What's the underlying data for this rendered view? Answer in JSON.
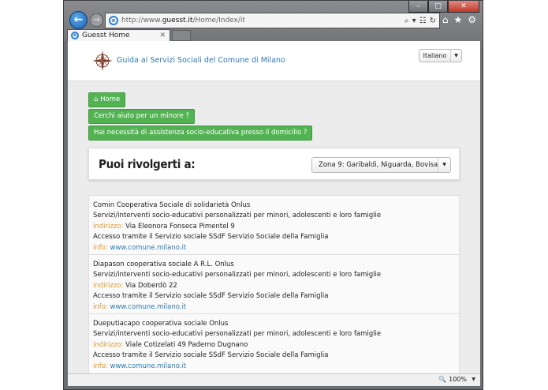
{
  "browser": {
    "url_prefix": "http://www.",
    "url_domain": "guesst.it",
    "url_path": "/Home/Index/it",
    "tab_title": "Guesst Home",
    "window_buttons": {
      "minimize": "–",
      "maximize": "□",
      "close": "✕"
    },
    "nav": {
      "back": "←",
      "forward": "→"
    },
    "address_tools": {
      "search": "⌕",
      "dropdown": "▾",
      "compat": "☷",
      "refresh": "↻"
    },
    "toolbar_icons": {
      "home": "⌂",
      "favorites": "★",
      "tools": "⚙"
    },
    "tab_close": "✕",
    "zoom": "100%",
    "icons": [
      "back-arrow-icon",
      "forward-arrow-icon",
      "ie-icon",
      "search-icon",
      "refresh-icon",
      "home-icon",
      "favorites-star-icon",
      "gear-icon",
      "zoom-icon"
    ]
  },
  "site": {
    "title": "Guida ai Servizi Sociali del Comune di Milano",
    "language": "Italiano",
    "logo_icon": "compass-rose-icon"
  },
  "breadcrumbs": [
    {
      "label": "Home",
      "icon": "home-icon"
    },
    {
      "label": "Cerchi aiuto per un minore ?"
    },
    {
      "label": "Hai necessità di assistenza socio-educativa presso il domicilio ?"
    }
  ],
  "filter": {
    "title": "Puoi rivolgerti a:",
    "zone": "Zona 9: Garibaldi, Niguarda, Bovisa"
  },
  "results": [
    {
      "name": "Comin Cooperativa Sociale di solidarietà Onlus",
      "service": "Servizi/interventi socio-educativi personalizzati per minori, adolescenti e loro famiglie",
      "address_label": "indirizzo:",
      "address": "Via Eleonora Fonseca Pimentel 9",
      "access": "Accesso tramite il Servizio sociale SSdF Servizio Sociale della Famiglia",
      "info_label": "info:",
      "info": "www.comune.milano.it"
    },
    {
      "name": "Diapason cooperativa sociale A R.L. Onlus",
      "service": "Servizi/interventi socio-educativi personalizzati per minori, adolescenti e loro famiglie",
      "address_label": "indirizzo:",
      "address": "Via Doberdò 22",
      "access": "Accesso tramite il Servizio sociale SSdF Servizio Sociale della Famiglia",
      "info_label": "info:",
      "info": "www.comune.milano.it"
    },
    {
      "name": "Dueputiacapo cooperativa sociale Onlus",
      "service": "Servizi/interventi socio-educativi personalizzati per minori, adolescenti e loro famiglie",
      "address_label": "indirizzo:",
      "address": "Viale Cotizelati 49 Paderno Dugnano",
      "access": "Accesso tramite il Servizio sociale SSdF Servizio Sociale della Famiglia",
      "info_label": "info:",
      "info": "www.comune.milano.it"
    }
  ],
  "colors": {
    "link": "#2a7ab8",
    "label": "#e09a2c",
    "button_green": "#53b353"
  }
}
